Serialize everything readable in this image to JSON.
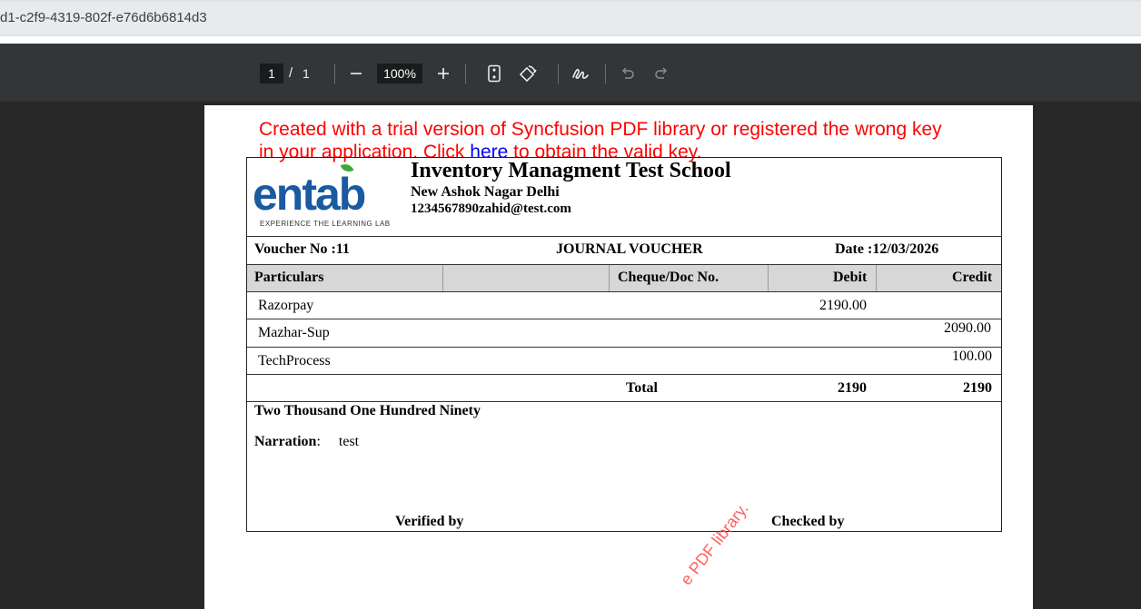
{
  "browser": {
    "url": "d1-c2f9-4319-802f-e76d6b6814d3"
  },
  "pdf_toolbar": {
    "current_page": "1",
    "page_separator": "/",
    "total_pages": "1",
    "zoom": "100%",
    "icons": [
      "zoom-out-icon",
      "zoom-in-icon",
      "fit-page-icon",
      "rotate-icon",
      "annotate-icon",
      "undo-icon",
      "redo-icon"
    ]
  },
  "trial_notice": {
    "line1": "Created with a trial version of Syncfusion PDF library or registered the wrong key",
    "line2_before": "in your application. Click ",
    "link": "here",
    "line2_after": " to obtain the valid key.",
    "color": "#ff0000",
    "link_color": "#0000ff"
  },
  "watermark": "e PDF library.",
  "school": {
    "logo_text": "entab",
    "logo_tagline": "EXPERIENCE THE LEARNING LAB",
    "name": "Inventory Managment Test School",
    "address": "New Ashok Nagar Delhi",
    "contact": "1234567890zahid@test.com"
  },
  "voucher": {
    "number_label": "Voucher No :11",
    "type": "JOURNAL VOUCHER",
    "date_label": "Date :12/03/2026"
  },
  "table": {
    "headers": {
      "particulars": "Particulars",
      "cheque": "Cheque/Doc No.",
      "debit": "Debit",
      "credit": "Credit"
    },
    "rows": [
      {
        "particulars": "Razorpay",
        "debit": "2190.00",
        "credit": ""
      },
      {
        "particulars": "Mazhar-Sup",
        "debit": "",
        "credit": "2090.00"
      },
      {
        "particulars": "TechProcess",
        "debit": "",
        "credit": "100.00"
      }
    ],
    "total": {
      "label": "Total",
      "debit": "2190",
      "credit": "2190"
    }
  },
  "amount_in_words": "Two Thousand One Hundred Ninety",
  "narration": {
    "label": "Narration",
    "colon": ":",
    "value": "test"
  },
  "signatures": {
    "verified": "Verified by",
    "checked": "Checked by"
  }
}
